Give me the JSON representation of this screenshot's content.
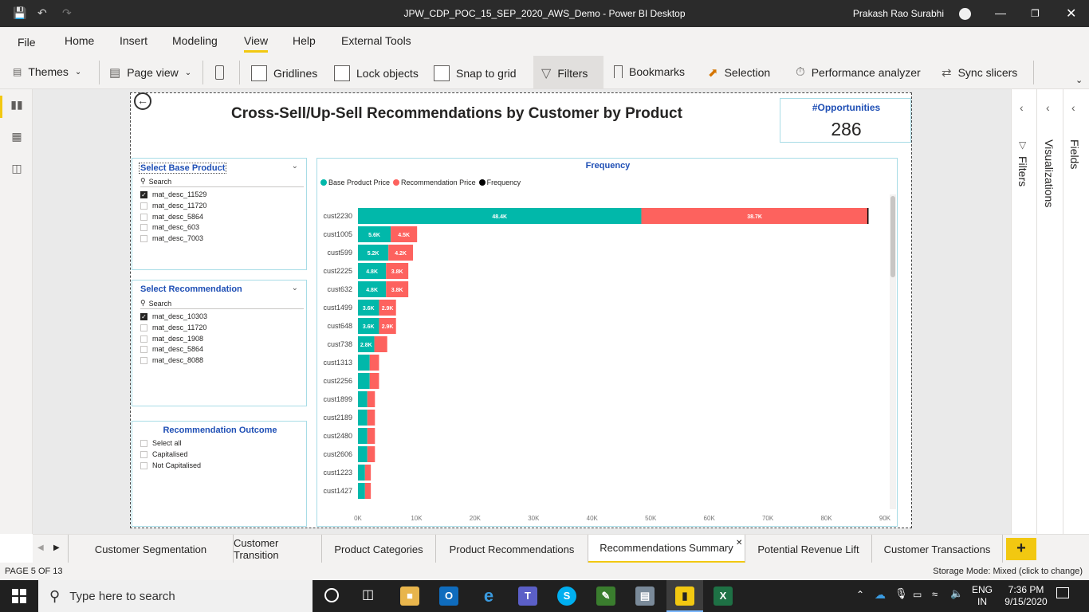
{
  "window": {
    "title": "JPW_CDP_POC_15_SEP_2020_AWS_Demo - Power BI Desktop",
    "user": "Prakash Rao Surabhi"
  },
  "menu": [
    "File",
    "Home",
    "Insert",
    "Modeling",
    "View",
    "Help",
    "External Tools"
  ],
  "menu_active": "View",
  "ribbon": {
    "themes": "Themes",
    "page_view": "Page view",
    "gridlines": "Gridlines",
    "lock_objects": "Lock objects",
    "snap_to_grid": "Snap to grid",
    "filters": "Filters",
    "bookmarks": "Bookmarks",
    "selection": "Selection",
    "performance_analyzer": "Performance analyzer",
    "sync_slicers": "Sync slicers"
  },
  "report": {
    "title": "Cross-Sell/Up-Sell Recommendations by Customer by Product",
    "kpi_label": "#Opportunities",
    "kpi_value": "286"
  },
  "slicer_base": {
    "title": "Select Base Product",
    "search": "Search",
    "items": [
      {
        "label": "mat_desc_11529",
        "checked": true
      },
      {
        "label": "mat_desc_11720",
        "checked": false
      },
      {
        "label": "mat_desc_5864",
        "checked": false
      },
      {
        "label": "mat_desc_603",
        "checked": false
      },
      {
        "label": "mat_desc_7003",
        "checked": false
      }
    ]
  },
  "slicer_rec": {
    "title": "Select Recommendation",
    "search": "Search",
    "items": [
      {
        "label": "mat_desc_10303",
        "checked": true
      },
      {
        "label": "mat_desc_11720",
        "checked": false
      },
      {
        "label": "mat_desc_1908",
        "checked": false
      },
      {
        "label": "mat_desc_5864",
        "checked": false
      },
      {
        "label": "mat_desc_8088",
        "checked": false
      }
    ]
  },
  "slicer_outcome": {
    "title": "Recommendation Outcome",
    "items": [
      "Select all",
      "Capitalised",
      "Not Capitalised"
    ]
  },
  "chart_data": {
    "type": "bar",
    "orientation": "horizontal",
    "stacked": true,
    "title": "Frequency",
    "categories": [
      "cust2230",
      "cust1005",
      "cust599",
      "cust2225",
      "cust632",
      "cust1499",
      "cust648",
      "cust738",
      "cust1313",
      "cust2256",
      "cust1899",
      "cust2189",
      "cust2480",
      "cust2606",
      "cust1223",
      "cust1427"
    ],
    "series": [
      {
        "name": "Base Product Price",
        "color": "#01b8aa",
        "values": [
          48400,
          5600,
          5200,
          4800,
          4800,
          3600,
          3600,
          2800,
          2000,
          2000,
          1600,
          1600,
          1600,
          1600,
          1200,
          1200
        ],
        "labels": [
          "48.4K",
          "5.6K",
          "5.2K",
          "4.8K",
          "4.8K",
          "3.6K",
          "3.6K",
          "2.8K",
          "",
          "",
          "",
          "",
          "",
          "",
          "",
          ""
        ]
      },
      {
        "name": "Recommendation Price",
        "color": "#fd625e",
        "values": [
          38700,
          4500,
          4200,
          3800,
          3800,
          2900,
          2900,
          2200,
          1600,
          1600,
          1300,
          1300,
          1300,
          1300,
          1000,
          1000
        ],
        "labels": [
          "38.7K",
          "4.5K",
          "4.2K",
          "3.8K",
          "3.8K",
          "2.9K",
          "2.9K",
          "",
          "",
          "",
          "",
          "",
          "",
          "",
          "",
          ""
        ]
      }
    ],
    "legend_extra": {
      "name": "Frequency",
      "color": "#000000"
    },
    "legend_position": "top-left",
    "xlim": [
      0,
      90000
    ],
    "xticks": [
      "0K",
      "10K",
      "20K",
      "30K",
      "40K",
      "50K",
      "60K",
      "70K",
      "80K",
      "90K"
    ]
  },
  "right_panes": {
    "filters": "Filters",
    "visualizations": "Visualizations",
    "fields": "Fields"
  },
  "tabs": [
    {
      "label": "Customer Segmentation",
      "active": false
    },
    {
      "label": "Customer Transition",
      "active": false
    },
    {
      "label": "Product Categories",
      "active": false
    },
    {
      "label": "Product Recommendations",
      "active": false
    },
    {
      "label": "Recommendations Summary",
      "active": true
    },
    {
      "label": "Potential Revenue Lift",
      "active": false
    },
    {
      "label": "Customer Transactions",
      "active": false
    }
  ],
  "status": {
    "page": "PAGE 5 OF 13",
    "storage": "Storage Mode: Mixed (click to change)"
  },
  "taskbar": {
    "search_placeholder": "Type here to search",
    "lang": "ENG",
    "region": "IN",
    "time": "7:36 PM",
    "date": "9/15/2020"
  }
}
